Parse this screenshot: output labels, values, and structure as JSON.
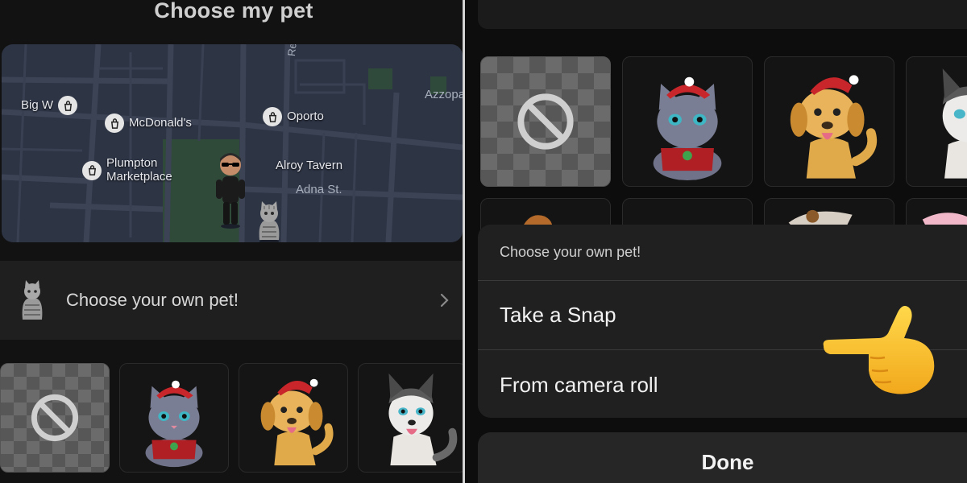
{
  "left": {
    "title": "Choose my pet",
    "map": {
      "pois": [
        {
          "id": "bigw",
          "label": "Big W",
          "icon": "shopping-bag-icon"
        },
        {
          "id": "mcd",
          "label": "McDonald's",
          "icon": "shopping-bag-icon"
        },
        {
          "id": "oporto",
          "label": "Oporto",
          "icon": "shopping-bag-icon"
        },
        {
          "id": "plumpton",
          "label": "Plumpton\nMarketplace",
          "icon": "shopping-bag-icon"
        },
        {
          "id": "alroy",
          "label": "Alroy Tavern",
          "icon": "pet-cat-icon"
        }
      ],
      "streets": {
        "adna": "Adna St.",
        "azzopa": "Azzopa",
        "rot": "Re"
      }
    },
    "choose_row": {
      "label": "Choose your own pet!",
      "icon": "chevron-right-icon"
    },
    "pets": [
      "none",
      "cat-santa",
      "dog-santa",
      "husky"
    ]
  },
  "right": {
    "grid": [
      "none",
      "cat-santa",
      "dog-santa",
      "husky"
    ],
    "sheet": {
      "header": "Choose your own pet!",
      "options": [
        "Take a Snap",
        "From camera roll"
      ]
    },
    "done_label": "Done",
    "pointer": "pointing-hand-emoji"
  },
  "colors": {
    "sheet_bg": "#202020",
    "map_bg": "#2d3444",
    "accent_red": "#c8262a",
    "dog_gold": "#e0a94a"
  }
}
